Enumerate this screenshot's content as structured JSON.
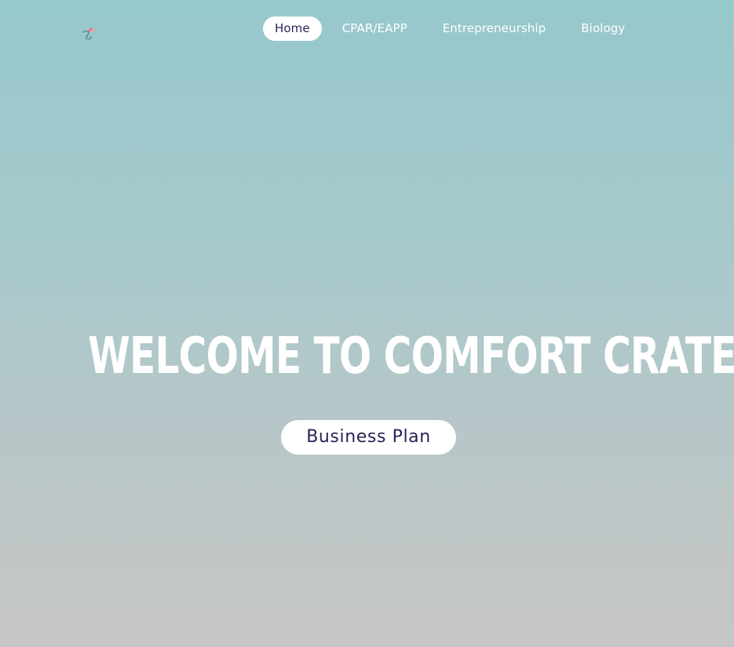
{
  "nav": {
    "items": [
      {
        "label": "Home",
        "active": true
      },
      {
        "label": "CPAR/EAPP",
        "active": false
      },
      {
        "label": "Entrepreneurship",
        "active": false
      },
      {
        "label": "Biology",
        "active": false
      }
    ]
  },
  "logo": {
    "icon": "flower-logo-icon"
  },
  "hero": {
    "title": "WELCOME TO COMFORT CRATE!",
    "button_label": "Business Plan"
  },
  "colors": {
    "gradient_top": "#96c8cc",
    "gradient_bottom": "#c6c6c6",
    "accent_text": "#2e1f55",
    "white": "#ffffff"
  }
}
